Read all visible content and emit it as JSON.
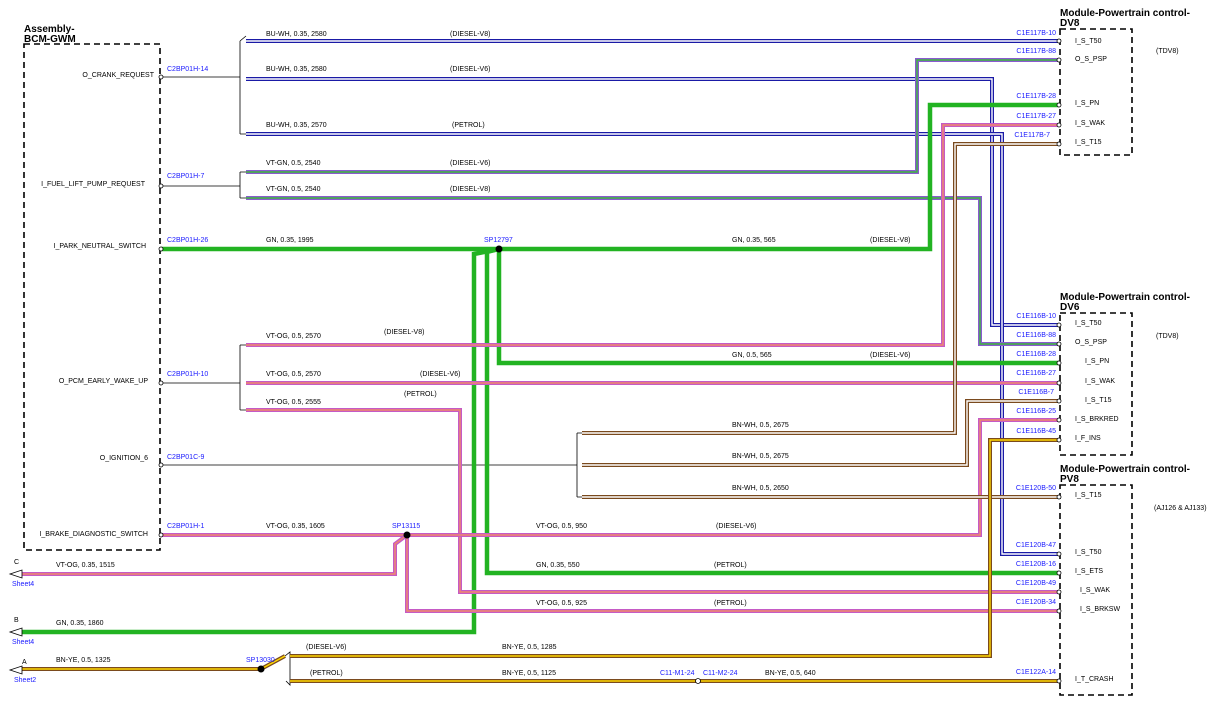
{
  "boxes": {
    "bcm": [
      "Assembly-",
      "BCM-GWM"
    ],
    "dv8": [
      "Module-Powertrain control-",
      "DV8"
    ],
    "dv6": [
      "Module-Powertrain control-",
      "DV6"
    ],
    "pv8": [
      "Module-Powertrain control-",
      "PV8"
    ]
  },
  "bcm_pins": [
    {
      "label": "O_CRANK_REQUEST",
      "conn": "C2BP01H-14"
    },
    {
      "label": "I_FUEL_LIFT_PUMP_REQUEST",
      "conn": "C2BP01H-7"
    },
    {
      "label": "I_PARK_NEUTRAL_SWITCH",
      "conn": "C2BP01H-26"
    },
    {
      "label": "O_PCM_EARLY_WAKE_UP",
      "conn": "C2BP01H-10"
    },
    {
      "label": "O_IGNITION_6",
      "conn": "C2BP01C-9"
    },
    {
      "label": "I_BRAKE_DIAGNOSTIC_SWITCH",
      "conn": "C2BP01H-1"
    }
  ],
  "dv8_pins": [
    {
      "label": "I_S_T50",
      "conn": "C1E117B-10"
    },
    {
      "label": "O_S_PSP",
      "conn": "C1E117B-88"
    },
    {
      "label": "I_S_PN",
      "conn": "C1E117B-28"
    },
    {
      "label": "I_S_WAK",
      "conn": "C1E117B-27"
    },
    {
      "label": "I_S_T15",
      "conn": "C1E117B-7"
    }
  ],
  "dv6_pins": [
    {
      "label": "I_S_T50",
      "conn": "C1E116B-10"
    },
    {
      "label": "O_S_PSP",
      "conn": "C1E116B-88"
    },
    {
      "label": "I_S_PN",
      "conn": "C1E116B-28"
    },
    {
      "label": "I_S_WAK",
      "conn": "C1E116B-27"
    },
    {
      "label": "I_S_T15",
      "conn": "C1E116B-7"
    },
    {
      "label": "I_S_BRKRED",
      "conn": "C1E116B-25"
    },
    {
      "label": "I_F_INS",
      "conn": "C1E116B-45"
    }
  ],
  "pv8_pins": [
    {
      "label": "I_S_T15",
      "conn": "C1E120B-50"
    },
    {
      "label": "I_S_T50",
      "conn": "C1E120B-47"
    },
    {
      "label": "I_S_ETS",
      "conn": "C1E120B-16"
    },
    {
      "label": "I_S_WAK",
      "conn": "C1E120B-49"
    },
    {
      "label": "I_S_BRKSW",
      "conn": "C1E120B-34"
    },
    {
      "label": "I_T_CRASH",
      "conn": "C1E122A-14"
    }
  ],
  "notes": {
    "dv8": "(TDV8)",
    "dv6": "(TDV8)",
    "pv8": "(AJ126 & AJ133)"
  },
  "wire_labels": {
    "w1": "BU-WH,  0.35,  2580",
    "w2": "BU-WH,  0.35,  2580",
    "w3": "BU-WH,  0.35,  2570",
    "w4": "VT-GN,  0.5,  2540",
    "w5": "VT-GN,  0.5,  2540",
    "w6": "GN,  0.35,  1995",
    "w7": "GN,  0.35,  565",
    "w8": "VT-OG,  0.5,  2570",
    "w9": "GN,  0.5,  565",
    "w10": "VT-OG,  0.5,  2570",
    "w11": "VT-OG,  0.5,  2555",
    "w12": "BN-WH,  0.5,  2675",
    "w13": "BN-WH,  0.5,  2675",
    "w14": "BN-WH,  0.5,  2650",
    "w15": "VT-OG,  0.35,  1605",
    "w16": "VT-OG,  0.5,  950",
    "w17": "VT-OG,  0.35,  1515",
    "w18": "GN,  0.35,  550",
    "w19": "VT-OG,  0.5,  925",
    "w20": "GN,  0.35,  1860",
    "w21": "BN-YE,  0.5,  1285",
    "w22": "BN-YE,  0.5,  1325",
    "w23": "BN-YE,  0.5,  1125",
    "w24": "BN-YE,  0.5,  640"
  },
  "variant_labels": {
    "v1": "(DIESEL-V8)",
    "v2": "(DIESEL-V6)",
    "v3": "(PETROL)",
    "v4": "(DIESEL-V6)",
    "v5": "(DIESEL-V8)",
    "v6": "(DIESEL-V8)",
    "v7": "(DIESEL-V8)",
    "v8": "(DIESEL-V6)",
    "v9": "(DIESEL-V6)",
    "v10": "(PETROL)",
    "v11": "(DIESEL-V6)",
    "v12": "(PETROL)",
    "v13": "(PETROL)",
    "v14": "(DIESEL-V6)",
    "v15": "(PETROL)"
  },
  "splices": {
    "sp1": "SP12797",
    "sp2": "SP13115",
    "sp3": "SP13030"
  },
  "inline_connectors": {
    "c1": "C11-M1-24",
    "c2": "C11-M2-24"
  },
  "sheet_refs": [
    {
      "letter": "C",
      "sheet": "Sheet4"
    },
    {
      "letter": "B",
      "sheet": "Sheet4"
    },
    {
      "letter": "A",
      "sheet": "Sheet2"
    }
  ],
  "wire_colors": {
    "BU-WH": [
      "#1a1aa6",
      "#ffffff"
    ],
    "VT-GN": [
      "#8a5ad0",
      "#3cb83c"
    ],
    "GN": [
      "#22b322",
      "#22b322"
    ],
    "VT-OG": [
      "#c55ac6",
      "#f08a6a"
    ],
    "BN-WH": [
      "#7a4a1e",
      "#ffffff"
    ],
    "BN-YE": [
      "#7a4a1e",
      "#ffd800"
    ]
  }
}
